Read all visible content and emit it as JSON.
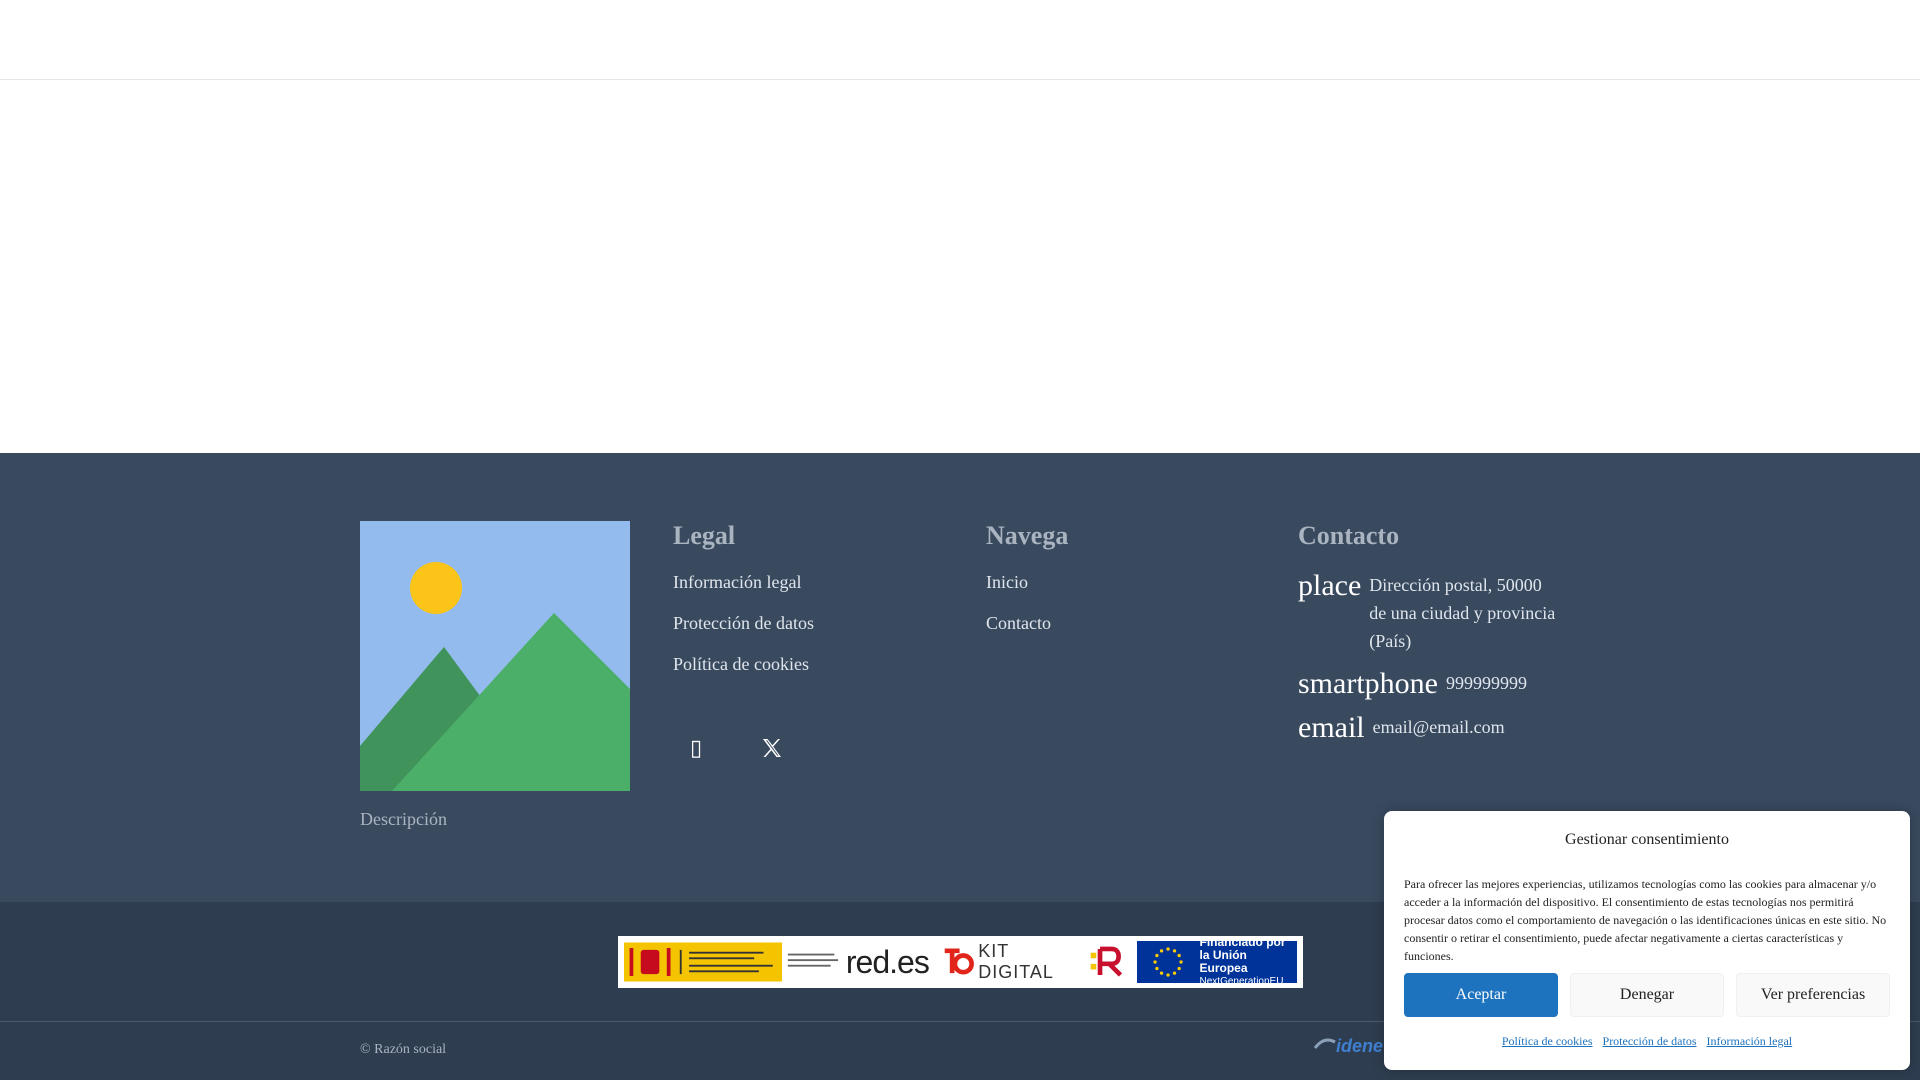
{
  "colors": {
    "footer_bg": "#394a5f",
    "subfooter_bg": "#2e3d50",
    "accent": "#1e73be"
  },
  "footer": {
    "image_icon": "image-placeholder-icon",
    "description": "Descripción",
    "legal": {
      "title": "Legal",
      "links": [
        "Información legal",
        "Protección de datos",
        "Política de cookies"
      ]
    },
    "social": {
      "icons": [
        "instagram-icon",
        "x-twitter-icon"
      ],
      "x_glyph": "𝕏",
      "square_glyph": "▯"
    },
    "navega": {
      "title": "Navega",
      "links": [
        "Inicio",
        "Contacto"
      ]
    },
    "contacto": {
      "title": "Contacto",
      "address_icon": "place",
      "address_lines": [
        "Dirección postal, 50000",
        "de una ciudad y provincia",
        "(País)"
      ],
      "phone_icon": "smartphone",
      "phone": "999999999",
      "email_icon": "email",
      "email": "email@email.com"
    }
  },
  "banner": {
    "red_es": "red.es",
    "kit_digital": "KIT DIGITAL",
    "eu_line1": "Financiado por",
    "eu_line2": "la Unión Europea",
    "eu_line3": "NextGenerationEU"
  },
  "bottom": {
    "copyright": "© Razón social",
    "brand": "idenet"
  },
  "cookie": {
    "title": "Gestionar consentimiento",
    "text": "Para ofrecer las mejores experiencias, utilizamos tecnologías como las cookies para almacenar y/o acceder a la información del dispositivo. El consentimiento de estas tecnologías nos permitirá procesar datos como el comportamiento de navegación o las identificaciones únicas en este sitio. No consentir o retirar el consentimiento, puede afectar negativamente a ciertas características y funciones.",
    "accept": "Aceptar",
    "deny": "Denegar",
    "preferences": "Ver preferencias",
    "links": [
      "Política de cookies",
      "Protección de datos",
      "Información legal"
    ]
  }
}
